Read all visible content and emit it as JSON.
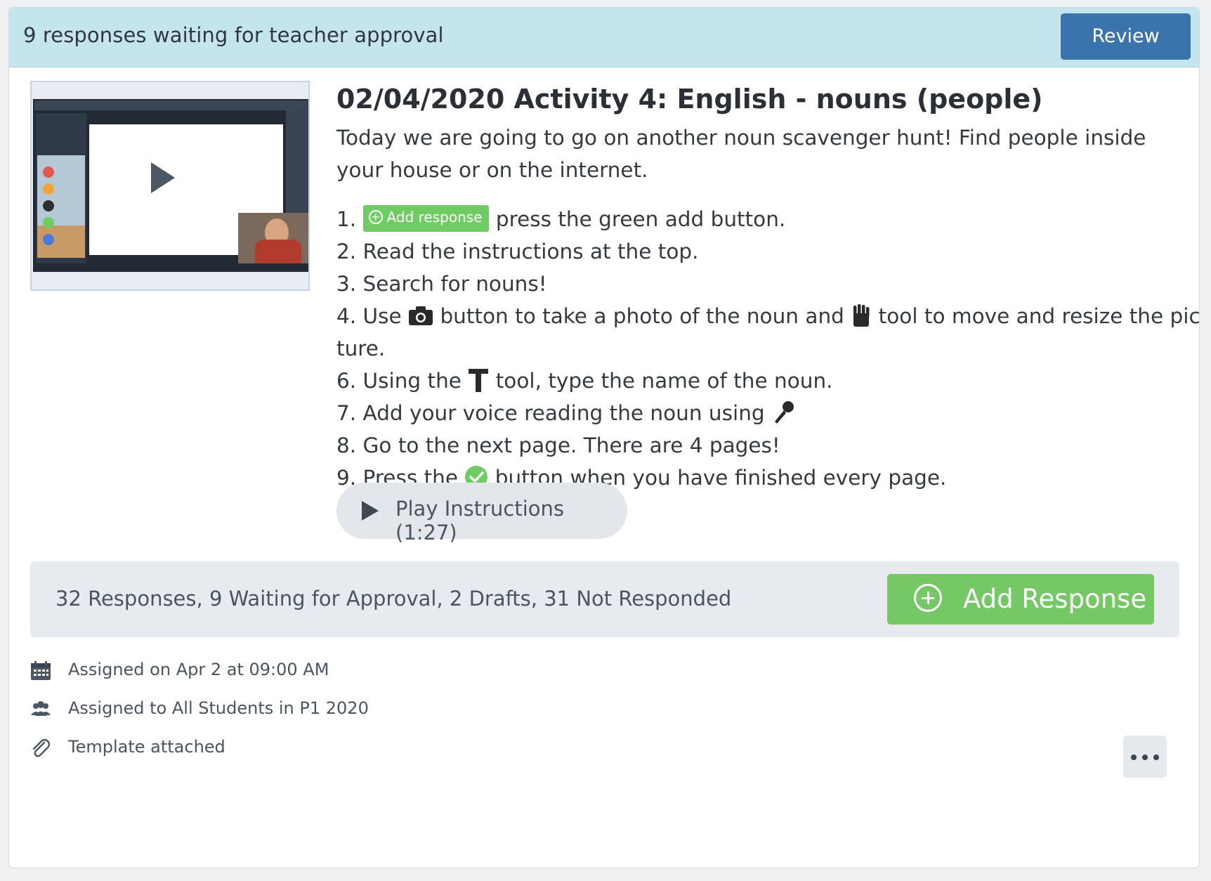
{
  "banner": {
    "text": "9 responses waiting for teacher approval",
    "review_label": "Review"
  },
  "activity": {
    "title": "02/04/2020 Activity 4: English - nouns (people)",
    "description": "Today we are going to go on another noun scavenger hunt! Find people inside your house or on the internet.",
    "inline_add_response_label": "Add response",
    "steps": [
      {
        "num": "1.",
        "before": "",
        "after": "press the green add button."
      },
      {
        "num": "2.",
        "text": "Read the instructions at the top."
      },
      {
        "num": "3.",
        "text": "Search for nouns!"
      },
      {
        "num": "4.",
        "before": "Use",
        "middle": "button to take a photo of the noun and",
        "after": "tool to move and resize the pic-",
        "continuation": "ture."
      },
      {
        "num": "6.",
        "before": "Using the",
        "after": "tool, type the name of the noun."
      },
      {
        "num": "7.",
        "before": "Add your voice reading the noun using"
      },
      {
        "num": "8.",
        "text": "Go to the next page. There are 4 pages!"
      },
      {
        "num": "9.",
        "before": "Press the",
        "after": "button when you have finished every page."
      }
    ],
    "play_label": "Play Instructions (1:27)"
  },
  "status": {
    "summary": "32 Responses, 9 Waiting for Approval, 2 Drafts, 31 Not Responded",
    "add_label": "Add Response"
  },
  "meta": {
    "assigned_on": "Assigned on Apr 2 at 09:00 AM",
    "assigned_to": "Assigned to All Students in P1 2020",
    "template": "Template attached"
  },
  "icons": {
    "calendar": "calendar-icon",
    "people": "people-icon",
    "paperclip": "paperclip-icon",
    "camera": "camera-icon",
    "move": "move-hand-icon",
    "text": "text-tool-icon",
    "mic": "microphone-icon",
    "check": "check-circle-icon",
    "more": "more-icon"
  },
  "colors": {
    "banner_bg": "#c4e5ee",
    "review_btn": "#3b74ad",
    "add_green": "#76c765",
    "status_bg": "#e7eaee"
  }
}
